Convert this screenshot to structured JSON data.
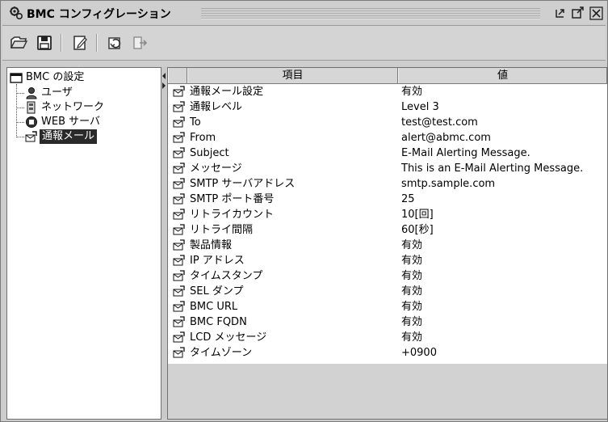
{
  "window": {
    "title": "BMC コンフィグレーション"
  },
  "toolbar": {
    "buttons": [
      "open-icon",
      "save-icon",
      "edit-icon",
      "refresh-icon",
      "export-icon"
    ]
  },
  "tree": {
    "root": "BMC の設定",
    "children": [
      {
        "label": "ユーザ",
        "icon": "user-icon"
      },
      {
        "label": "ネットワーク",
        "icon": "network-icon"
      },
      {
        "label": "WEB サーバ",
        "icon": "web-server-icon"
      },
      {
        "label": "通報メール",
        "icon": "mail-icon",
        "selected": true
      }
    ]
  },
  "grid": {
    "headers": {
      "item": "項目",
      "value": "値"
    },
    "rows": [
      {
        "item": "通報メール設定",
        "value": "有効"
      },
      {
        "item": "通報レベル",
        "value": "Level 3"
      },
      {
        "item": "To",
        "value": "test@test.com"
      },
      {
        "item": "From",
        "value": "alert@abmc.com"
      },
      {
        "item": "Subject",
        "value": "E-Mail Alerting Message."
      },
      {
        "item": "メッセージ",
        "value": "This is an E-Mail Alerting Message."
      },
      {
        "item": "SMTP サーバアドレス",
        "value": "smtp.sample.com"
      },
      {
        "item": "SMTP ポート番号",
        "value": "25"
      },
      {
        "item": "リトライカウント",
        "value": "10[回]"
      },
      {
        "item": "リトライ間隔",
        "value": "60[秒]"
      },
      {
        "item": "製品情報",
        "value": "有効"
      },
      {
        "item": "IP アドレス",
        "value": "有効"
      },
      {
        "item": "タイムスタンプ",
        "value": "有効"
      },
      {
        "item": "SEL ダンプ",
        "value": "有効"
      },
      {
        "item": "BMC URL",
        "value": "有効"
      },
      {
        "item": "BMC FQDN",
        "value": "有効"
      },
      {
        "item": "LCD メッセージ",
        "value": "有効"
      },
      {
        "item": "タイムゾーン",
        "value": "+0900"
      }
    ]
  }
}
